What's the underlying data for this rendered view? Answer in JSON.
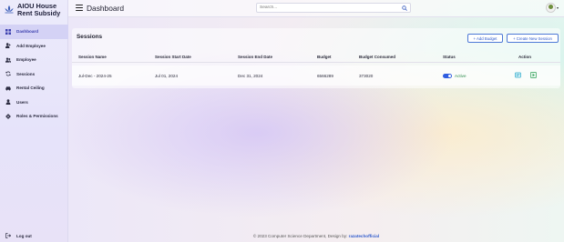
{
  "sidebar": {
    "brand_line1": "AIOU House",
    "brand_line2": "Rent Subsidy",
    "items": [
      {
        "label": "Dashboard",
        "icon": "grid-icon",
        "active": true
      },
      {
        "label": "Add Employee",
        "icon": "add-user-icon"
      },
      {
        "label": "Employee",
        "icon": "users-icon"
      },
      {
        "label": "Sessions",
        "icon": "sync-icon"
      },
      {
        "label": "Rental Ceiling",
        "icon": "car-icon"
      },
      {
        "label": "Users",
        "icon": "user-icon"
      },
      {
        "label": "Roles & Permissions",
        "icon": "gear-icon"
      }
    ],
    "logout_label": "Log out"
  },
  "topbar": {
    "title": "Dashboard",
    "search_placeholder": "Search..."
  },
  "sessions": {
    "title": "Sessions",
    "add_budget_label": "+ Add Budget",
    "create_session_label": "+ Create New Session",
    "columns": [
      "Session Name",
      "Session Start Date",
      "Session End Date",
      "Budget",
      "Budget Consumed",
      "Status",
      "Action"
    ],
    "rows": [
      {
        "name": "Jul-Dec - 2024-25",
        "start": "Jul 01, 2024",
        "end": "Dec 31, 2024",
        "budget": "6566289",
        "consumed": "373020",
        "status": "Active"
      }
    ]
  },
  "footer": {
    "text": "© 2023 Computer Science Department, Design by:",
    "link": "razatechofficial"
  },
  "colors": {
    "accent": "#2f5bcc",
    "active_status": "#2a8a4a",
    "sidebar_active": "#d4d2f5"
  }
}
